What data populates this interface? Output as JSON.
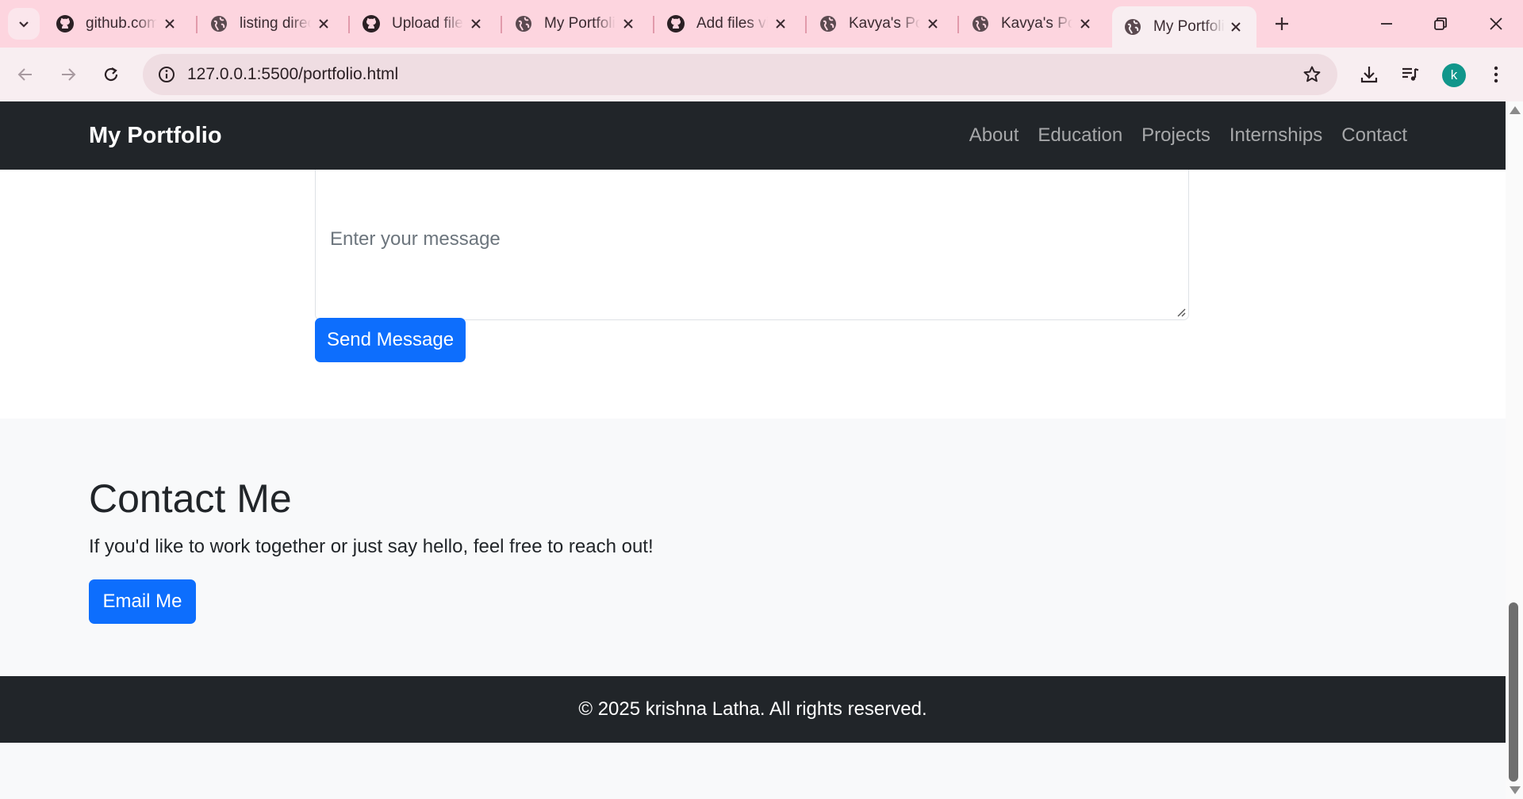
{
  "browser": {
    "tabs": [
      {
        "title": "github.com",
        "icon": "github-icon"
      },
      {
        "title": "listing directory",
        "icon": "globe-icon"
      },
      {
        "title": "Upload files",
        "icon": "github-icon"
      },
      {
        "title": "My Portfolio",
        "icon": "globe-icon"
      },
      {
        "title": "Add files via",
        "icon": "github-icon"
      },
      {
        "title": "Kavya's Portfolio",
        "icon": "globe-icon"
      },
      {
        "title": "Kavya's Portfolio",
        "icon": "globe-icon"
      },
      {
        "title": "My Portfolio",
        "icon": "globe-icon",
        "active": true
      }
    ],
    "url": "127.0.0.1:5500/portfolio.html",
    "profile_initial": "k",
    "colors": {
      "tabstrip": "#fdd5df",
      "toolbar": "#f8eef1",
      "avatar": "#11968b"
    }
  },
  "page": {
    "navbar": {
      "brand": "My Portfolio",
      "links": [
        "About",
        "Education",
        "Projects",
        "Internships",
        "Contact"
      ]
    },
    "form": {
      "message_placeholder": "Enter your message",
      "send_label": "Send Message"
    },
    "contact": {
      "heading": "Contact Me",
      "text": "If you'd like to work together or just say hello, feel free to reach out!",
      "email_label": "Email Me"
    },
    "footer": {
      "text": "© 2025 krishna Latha. All rights reserved."
    },
    "colors": {
      "primary": "#0d6efd",
      "dark": "#212529",
      "light": "#f8f9fa"
    }
  }
}
